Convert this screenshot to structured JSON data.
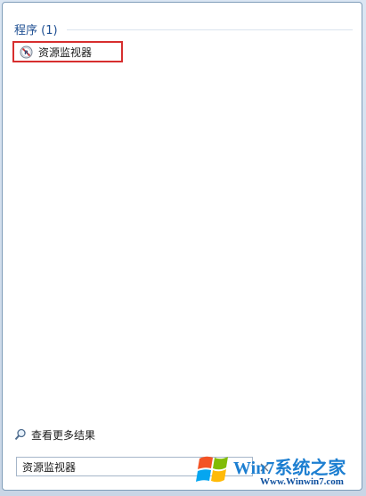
{
  "results": {
    "section_title": "程序 (1)",
    "program_label": "资源监视器",
    "program_icon": "resource-monitor-icon",
    "highlight_color": "#d72e2e"
  },
  "footer": {
    "see_more_label": "查看更多结果",
    "see_more_icon": "magnifier-icon"
  },
  "search": {
    "value": "资源监视器",
    "clear_icon": "clear-x-icon"
  },
  "watermark": {
    "brand": "Win7系统之家",
    "url": "Www.Winwin7.com"
  }
}
